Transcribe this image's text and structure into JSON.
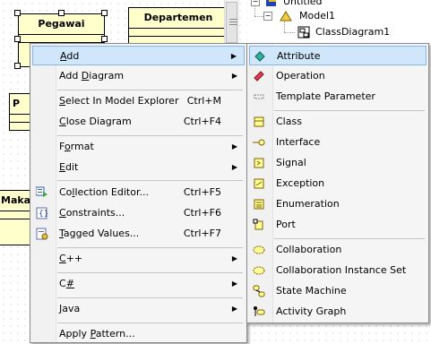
{
  "diagram": {
    "classes": {
      "pegawai": "Pegawai",
      "departemen": "Departemen",
      "partial_left": "P",
      "partial_bottom": "Maka"
    }
  },
  "explorer": {
    "root": "Untitled",
    "model": "Model1",
    "diagram": "ClassDiagram1"
  },
  "context_menu": {
    "items": {
      "add": {
        "pre": "",
        "u": "A",
        "post": "dd",
        "shortcut": ""
      },
      "add_diagram": {
        "pre": "Add ",
        "u": "D",
        "post": "iagram",
        "shortcut": ""
      },
      "select_in_model_explorer": {
        "pre": "",
        "u": "S",
        "post": "elect In Model Explorer",
        "shortcut": "Ctrl+M"
      },
      "close_diagram": {
        "pre": "",
        "u": "C",
        "post": "lose Diagram",
        "shortcut": "Ctrl+F4"
      },
      "format": {
        "pre": "F",
        "u": "o",
        "post": "rmat",
        "shortcut": ""
      },
      "edit": {
        "pre": "",
        "u": "E",
        "post": "dit",
        "shortcut": ""
      },
      "collection_editor": {
        "pre": "Co",
        "u": "l",
        "post": "lection Editor...",
        "shortcut": "Ctrl+F5"
      },
      "constraints": {
        "pre": "",
        "u": "C",
        "post": "onstraints...",
        "shortcut": "Ctrl+F6"
      },
      "tagged_values": {
        "pre": "",
        "u": "T",
        "post": "agged Values...",
        "shortcut": "Ctrl+F7"
      },
      "cpp": {
        "pre": "",
        "u": "C",
        "post": "++",
        "shortcut": ""
      },
      "csharp": {
        "pre": "C",
        "u": "#",
        "post": "",
        "shortcut": ""
      },
      "java": {
        "pre": "",
        "u": "J",
        "post": "ava",
        "shortcut": ""
      },
      "apply_pattern": {
        "pre": "Apply ",
        "u": "P",
        "post": "attern...",
        "shortcut": ""
      }
    }
  },
  "submenu": {
    "items": {
      "attribute": "Attribute",
      "operation": "Operation",
      "template_parameter": "Template Parameter",
      "class": "Class",
      "interface": "Interface",
      "signal": "Signal",
      "exception": "Exception",
      "enumeration": "Enumeration",
      "port": "Port",
      "collaboration": "Collaboration",
      "collaboration_instance_set": "Collaboration Instance Set",
      "state_machine": "State Machine",
      "activity_graph": "Activity Graph"
    }
  },
  "colors": {
    "class_fill": "#ffffcc",
    "menu_bg": "#f5f5f5",
    "highlight_bg": "#cfe6fb",
    "highlight_border": "#84b5e6"
  }
}
